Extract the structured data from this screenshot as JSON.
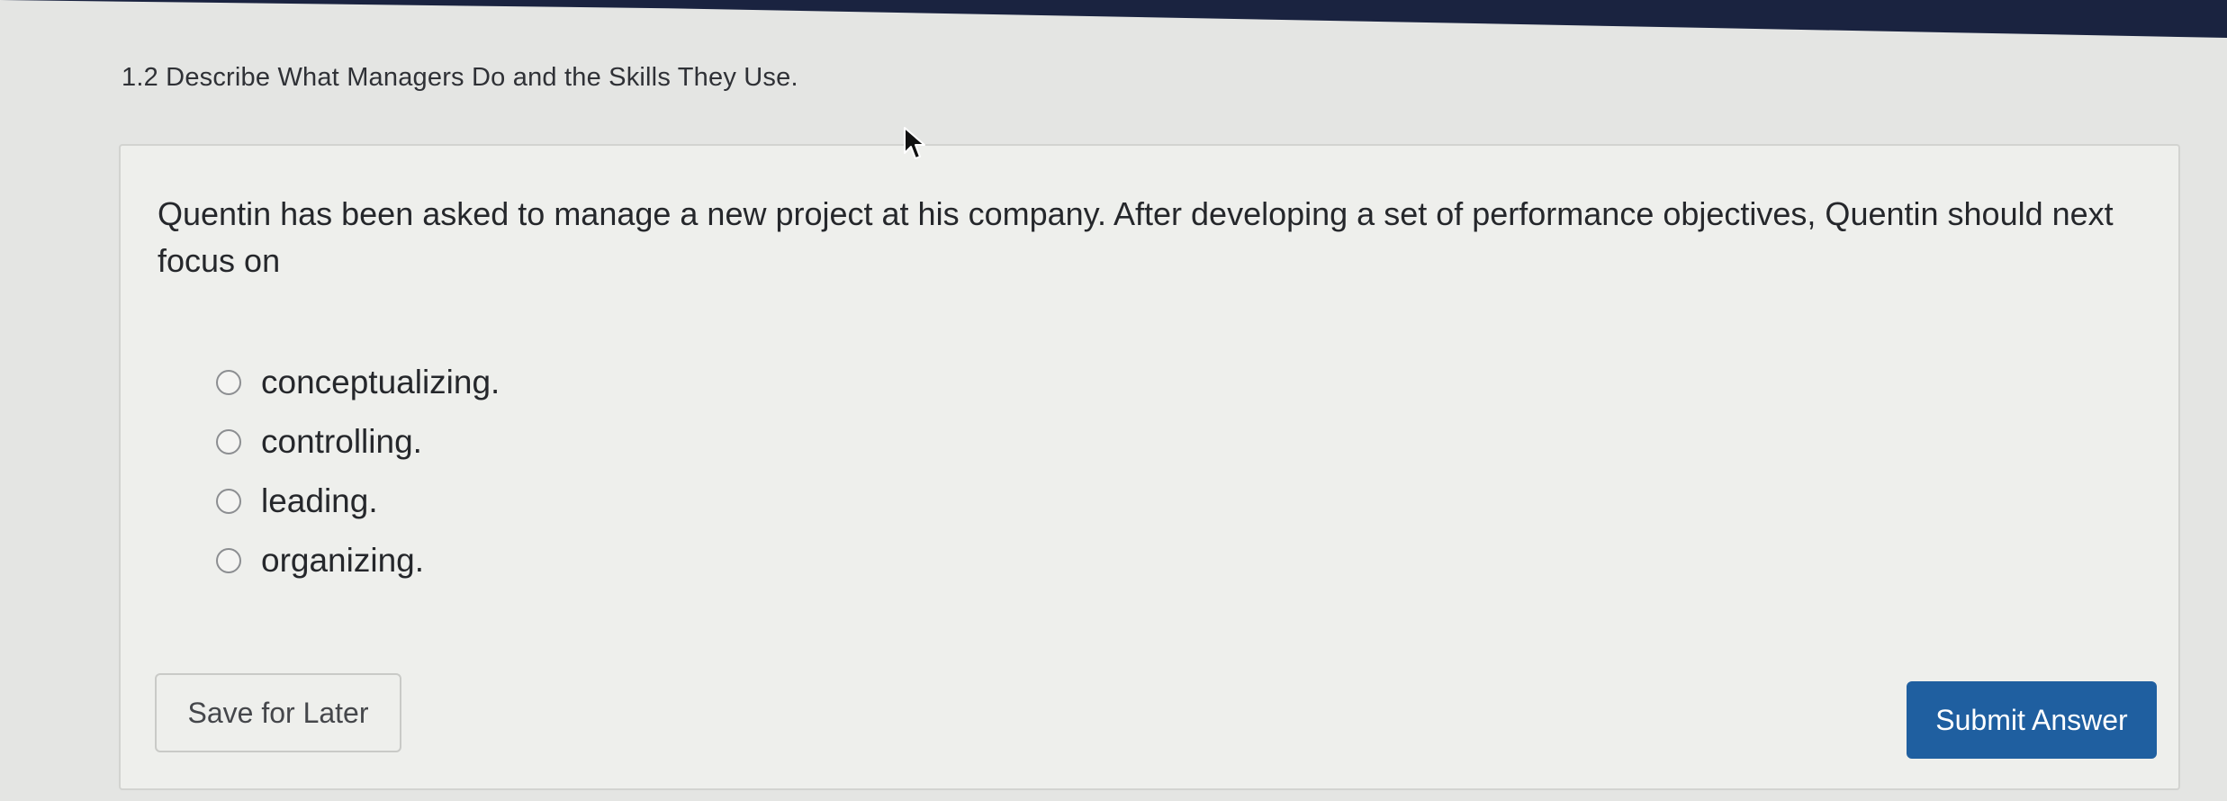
{
  "section": {
    "title": "1.2 Describe What Managers Do and the Skills They Use."
  },
  "question": {
    "text": "Quentin has been asked to manage a new project at his company. After developing a set of performance objectives, Quentin should next focus on",
    "options": [
      {
        "label": "conceptualizing."
      },
      {
        "label": "controlling."
      },
      {
        "label": "leading."
      },
      {
        "label": "organizing."
      }
    ]
  },
  "actions": {
    "save_label": "Save for Later",
    "submit_label": "Submit Answer"
  },
  "colors": {
    "submit_bg": "#1f5fa0",
    "top_bar": "#1a2340"
  },
  "icons": {
    "cursor": "mouse-pointer-icon"
  }
}
